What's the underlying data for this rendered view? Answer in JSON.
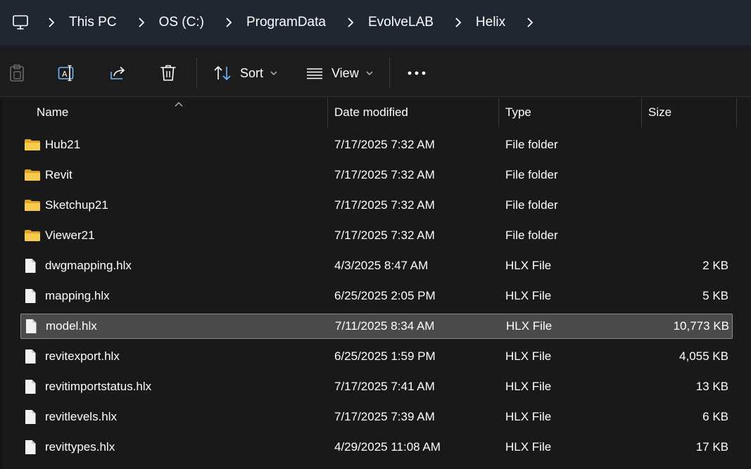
{
  "breadcrumb": {
    "items": [
      "This PC",
      "OS (C:)",
      "ProgramData",
      "EvolveLAB",
      "Helix"
    ]
  },
  "toolbar": {
    "sort_label": "Sort",
    "view_label": "View"
  },
  "columns": {
    "name": "Name",
    "date": "Date modified",
    "type": "Type",
    "size": "Size"
  },
  "files": [
    {
      "name": "Hub21",
      "date": "7/17/2025 7:32 AM",
      "type": "File folder",
      "size": "",
      "kind": "folder"
    },
    {
      "name": "Revit",
      "date": "7/17/2025 7:32 AM",
      "type": "File folder",
      "size": "",
      "kind": "folder"
    },
    {
      "name": "Sketchup21",
      "date": "7/17/2025 7:32 AM",
      "type": "File folder",
      "size": "",
      "kind": "folder"
    },
    {
      "name": "Viewer21",
      "date": "7/17/2025 7:32 AM",
      "type": "File folder",
      "size": "",
      "kind": "folder"
    },
    {
      "name": "dwgmapping.hlx",
      "date": "4/3/2025 8:47 AM",
      "type": "HLX File",
      "size": "2 KB",
      "kind": "file"
    },
    {
      "name": "mapping.hlx",
      "date": "6/25/2025 2:05 PM",
      "type": "HLX File",
      "size": "5 KB",
      "kind": "file"
    },
    {
      "name": "model.hlx",
      "date": "7/11/2025 8:34 AM",
      "type": "HLX File",
      "size": "10,773 KB",
      "kind": "file"
    },
    {
      "name": "revitexport.hlx",
      "date": "6/25/2025 1:59 PM",
      "type": "HLX File",
      "size": "4,055 KB",
      "kind": "file"
    },
    {
      "name": "revitimportstatus.hlx",
      "date": "7/17/2025 7:41 AM",
      "type": "HLX File",
      "size": "13 KB",
      "kind": "file"
    },
    {
      "name": "revitlevels.hlx",
      "date": "7/17/2025 7:39 AM",
      "type": "HLX File",
      "size": "6 KB",
      "kind": "file"
    },
    {
      "name": "revittypes.hlx",
      "date": "4/29/2025 11:08 AM",
      "type": "HLX File",
      "size": "17 KB",
      "kind": "file"
    }
  ],
  "selected_file": "model.hlx",
  "colors": {
    "addressbar_bg": "#202731",
    "content_bg": "#191919",
    "selection_bg": "#4a4a4a",
    "folder_yellow": "#f4c542"
  }
}
